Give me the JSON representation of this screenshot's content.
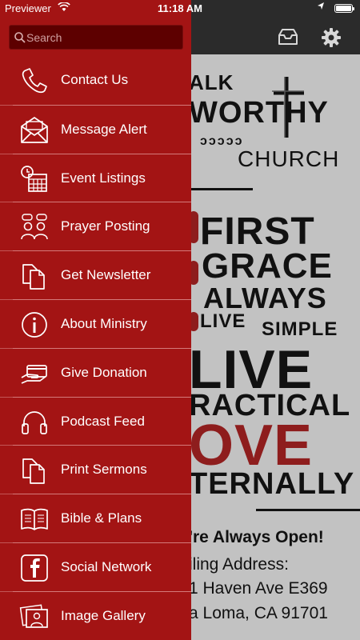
{
  "status_bar": {
    "carrier": "Previewer",
    "time": "11:18 AM",
    "battery_level": 1.0,
    "icons": [
      "wifi-icon",
      "location-icon",
      "battery-icon"
    ]
  },
  "drawer": {
    "search": {
      "placeholder": "Search",
      "value": ""
    },
    "items": [
      {
        "label": "Contact Us",
        "icon": "phone-icon"
      },
      {
        "label": "Message Alert",
        "icon": "envelope-icon"
      },
      {
        "label": "Event Listings",
        "icon": "calendar-clock-icon"
      },
      {
        "label": "Prayer Posting",
        "icon": "people-chat-icon"
      },
      {
        "label": "Get Newsletter",
        "icon": "documents-icon"
      },
      {
        "label": "About Ministry",
        "icon": "info-icon"
      },
      {
        "label": "Give Donation",
        "icon": "hand-card-icon"
      },
      {
        "label": "Podcast Feed",
        "icon": "headphones-icon"
      },
      {
        "label": "Print Sermons",
        "icon": "documents-icon"
      },
      {
        "label": "Bible & Plans",
        "icon": "open-book-icon"
      },
      {
        "label": "Social Network",
        "icon": "facebook-icon"
      },
      {
        "label": "Image Gallery",
        "icon": "photos-icon"
      }
    ]
  },
  "header": {
    "icons": [
      "inbox-icon",
      "gear-icon"
    ]
  },
  "main": {
    "logo": {
      "line1": "ALK",
      "line2": "WORTHY",
      "steps": "ɔɔɔɔɔ",
      "line3": "CHURCH"
    },
    "word_art": {
      "first": "FIRST",
      "grace": "GRACE",
      "always": "ALWAYS",
      "live_small": "LIVE",
      "simple": "SIMPLE",
      "live_big": "LIVE",
      "practical": "RACTICAL",
      "love": "OVE",
      "eternally": "TERNALLY"
    },
    "open_text": "'re Always Open!",
    "address_label": "iling Address:",
    "address_line1": "1 Haven Ave E369",
    "address_line2": "a Loma, CA 91701"
  },
  "colors": {
    "drawer_bg": "#a31414",
    "search_bg": "#5d0000",
    "nav_bg": "#2b2b2b",
    "accent_red": "#8e1d1d"
  }
}
